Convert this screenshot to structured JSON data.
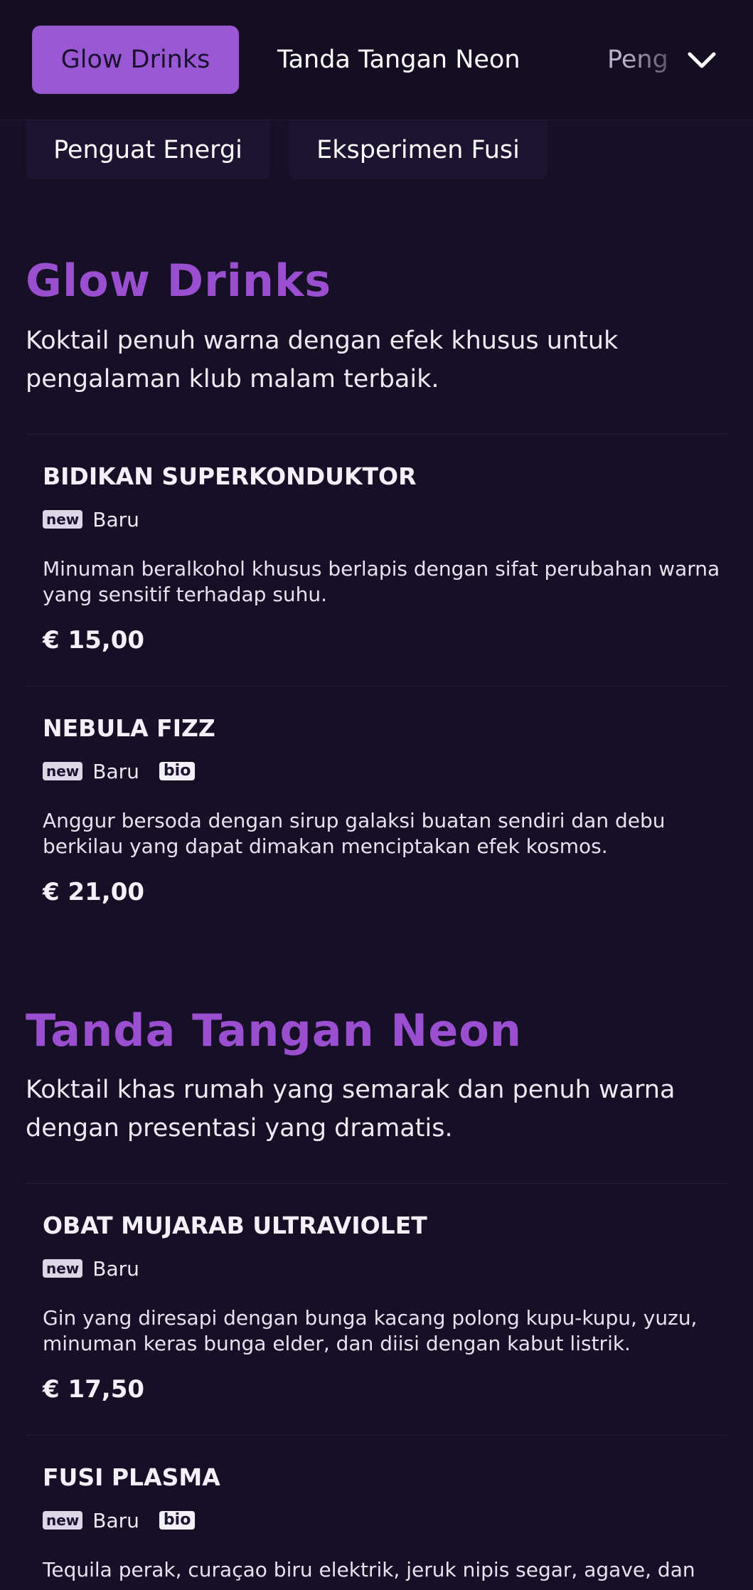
{
  "nav": {
    "tabs": [
      {
        "label": "Glow Drinks",
        "active": true
      },
      {
        "label": "Tanda Tangan Neon",
        "active": false
      },
      {
        "label": "Peng",
        "active": false
      }
    ],
    "more_icon": "chevron-down-icon",
    "secondary_tabs": [
      {
        "label": "Penguat Energi"
      },
      {
        "label": "Eksperimen Fusi"
      }
    ]
  },
  "sections": [
    {
      "title": "Glow Drinks",
      "description": "Koktail penuh warna dengan efek khusus untuk pengalaman klub malam terbaik.",
      "items": [
        {
          "name": "BIDIKAN SUPERKONDUKTOR",
          "badge_new": "new",
          "badge_label": "Baru",
          "description": "Minuman beralkohol khusus berlapis dengan sifat perubahan warna yang sensitif terhadap suhu.",
          "price": "€ 15,00"
        },
        {
          "name": "NEBULA FIZZ",
          "badge_new": "new",
          "badge_label": "Baru",
          "badge_bio": "bio",
          "description": "Anggur bersoda dengan sirup galaksi buatan sendiri dan debu berkilau yang dapat dimakan menciptakan efek kosmos.",
          "price": "€ 21,00"
        }
      ]
    },
    {
      "title": "Tanda Tangan Neon",
      "description": "Koktail khas rumah yang semarak dan penuh warna dengan presentasi yang dramatis.",
      "items": [
        {
          "name": "OBAT MUJARAB ULTRAVIOLET",
          "badge_new": "new",
          "badge_label": "Baru",
          "description": "Gin yang diresapi dengan bunga kacang polong kupu-kupu, yuzu, minuman keras bunga elder, dan diisi dengan kabut listrik.",
          "price": "€ 17,50"
        },
        {
          "name": "FUSI PLASMA",
          "badge_new": "new",
          "badge_label": "Baru",
          "badge_bio": "bio",
          "description": "Tequila perak, curaçao biru elektrik, jeruk nipis segar, agave, dan"
        }
      ]
    }
  ],
  "colors": {
    "background": "#160f26",
    "accent": "#9a58d4",
    "section_title": "#9a4fd1"
  }
}
